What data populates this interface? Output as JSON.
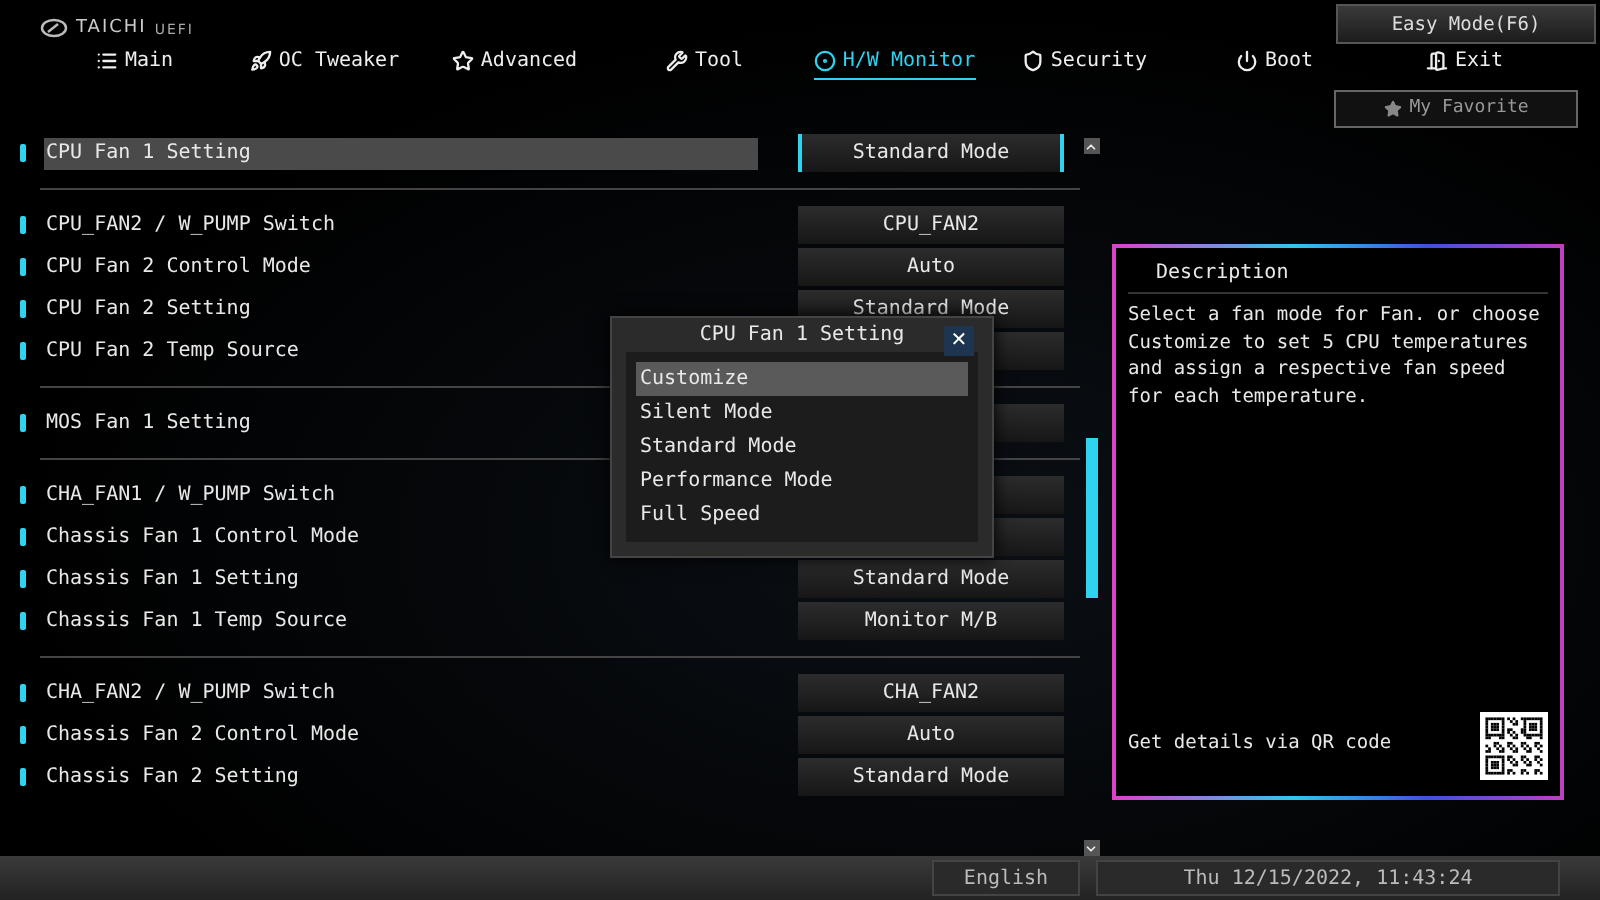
{
  "header": {
    "brand": "TAICHI",
    "brand_suffix": "UEFI",
    "easy_mode_button": "Easy Mode(F6)",
    "favorite_button": "My Favorite"
  },
  "tabs": [
    {
      "label": "Main",
      "selected": false
    },
    {
      "label": "OC Tweaker",
      "selected": false
    },
    {
      "label": "Advanced",
      "selected": false
    },
    {
      "label": "Tool",
      "selected": false
    },
    {
      "label": "H/W Monitor",
      "selected": true
    },
    {
      "label": "Security",
      "selected": false
    },
    {
      "label": "Boot",
      "selected": false
    },
    {
      "label": "Exit",
      "selected": false
    }
  ],
  "settings_groups": [
    {
      "rows": [
        {
          "label": "CPU Fan 1 Setting",
          "value": "Standard Mode",
          "selected": true
        }
      ]
    },
    {
      "rows": [
        {
          "label": "CPU_FAN2 / W_PUMP Switch",
          "value": "CPU_FAN2",
          "selected": false
        },
        {
          "label": "CPU Fan 2 Control Mode",
          "value": "Auto",
          "selected": false
        },
        {
          "label": "CPU Fan 2 Setting",
          "value": "Standard Mode",
          "selected": false
        },
        {
          "label": "CPU Fan 2 Temp Source",
          "selected": false
        }
      ]
    },
    {
      "rows": [
        {
          "label": "MOS Fan 1 Setting",
          "selected": false
        }
      ]
    },
    {
      "rows": [
        {
          "label": "CHA_FAN1 / W_PUMP Switch",
          "selected": false
        },
        {
          "label": "Chassis Fan 1 Control Mode",
          "selected": false
        },
        {
          "label": "Chassis Fan 1 Setting",
          "value": "Standard Mode",
          "selected": false
        },
        {
          "label": "Chassis Fan 1 Temp Source",
          "value": "Monitor M/B",
          "selected": false
        }
      ]
    },
    {
      "rows": [
        {
          "label": "CHA_FAN2 / W_PUMP Switch",
          "value": "CHA_FAN2",
          "selected": false
        },
        {
          "label": "Chassis Fan 2 Control Mode",
          "value": "Auto",
          "selected": false
        },
        {
          "label": "Chassis Fan 2 Setting",
          "value": "Standard Mode",
          "selected": false
        }
      ]
    }
  ],
  "dialog": {
    "title": "CPU Fan 1 Setting",
    "close": "✕",
    "options": [
      {
        "label": "Customize",
        "selected": true
      },
      {
        "label": "Silent Mode",
        "selected": false
      },
      {
        "label": "Standard Mode",
        "selected": false
      },
      {
        "label": "Performance Mode",
        "selected": false
      },
      {
        "label": "Full Speed",
        "selected": false
      }
    ]
  },
  "description": {
    "title": "Description",
    "text": "Select a fan mode for Fan. or choose Customize to set 5 CPU temperatures and assign a respective fan speed for each temperature.",
    "qr_label": "Get details via QR code"
  },
  "status_bar": {
    "language": "English",
    "datetime": "Thu 12/15/2022, 11:43:24"
  }
}
